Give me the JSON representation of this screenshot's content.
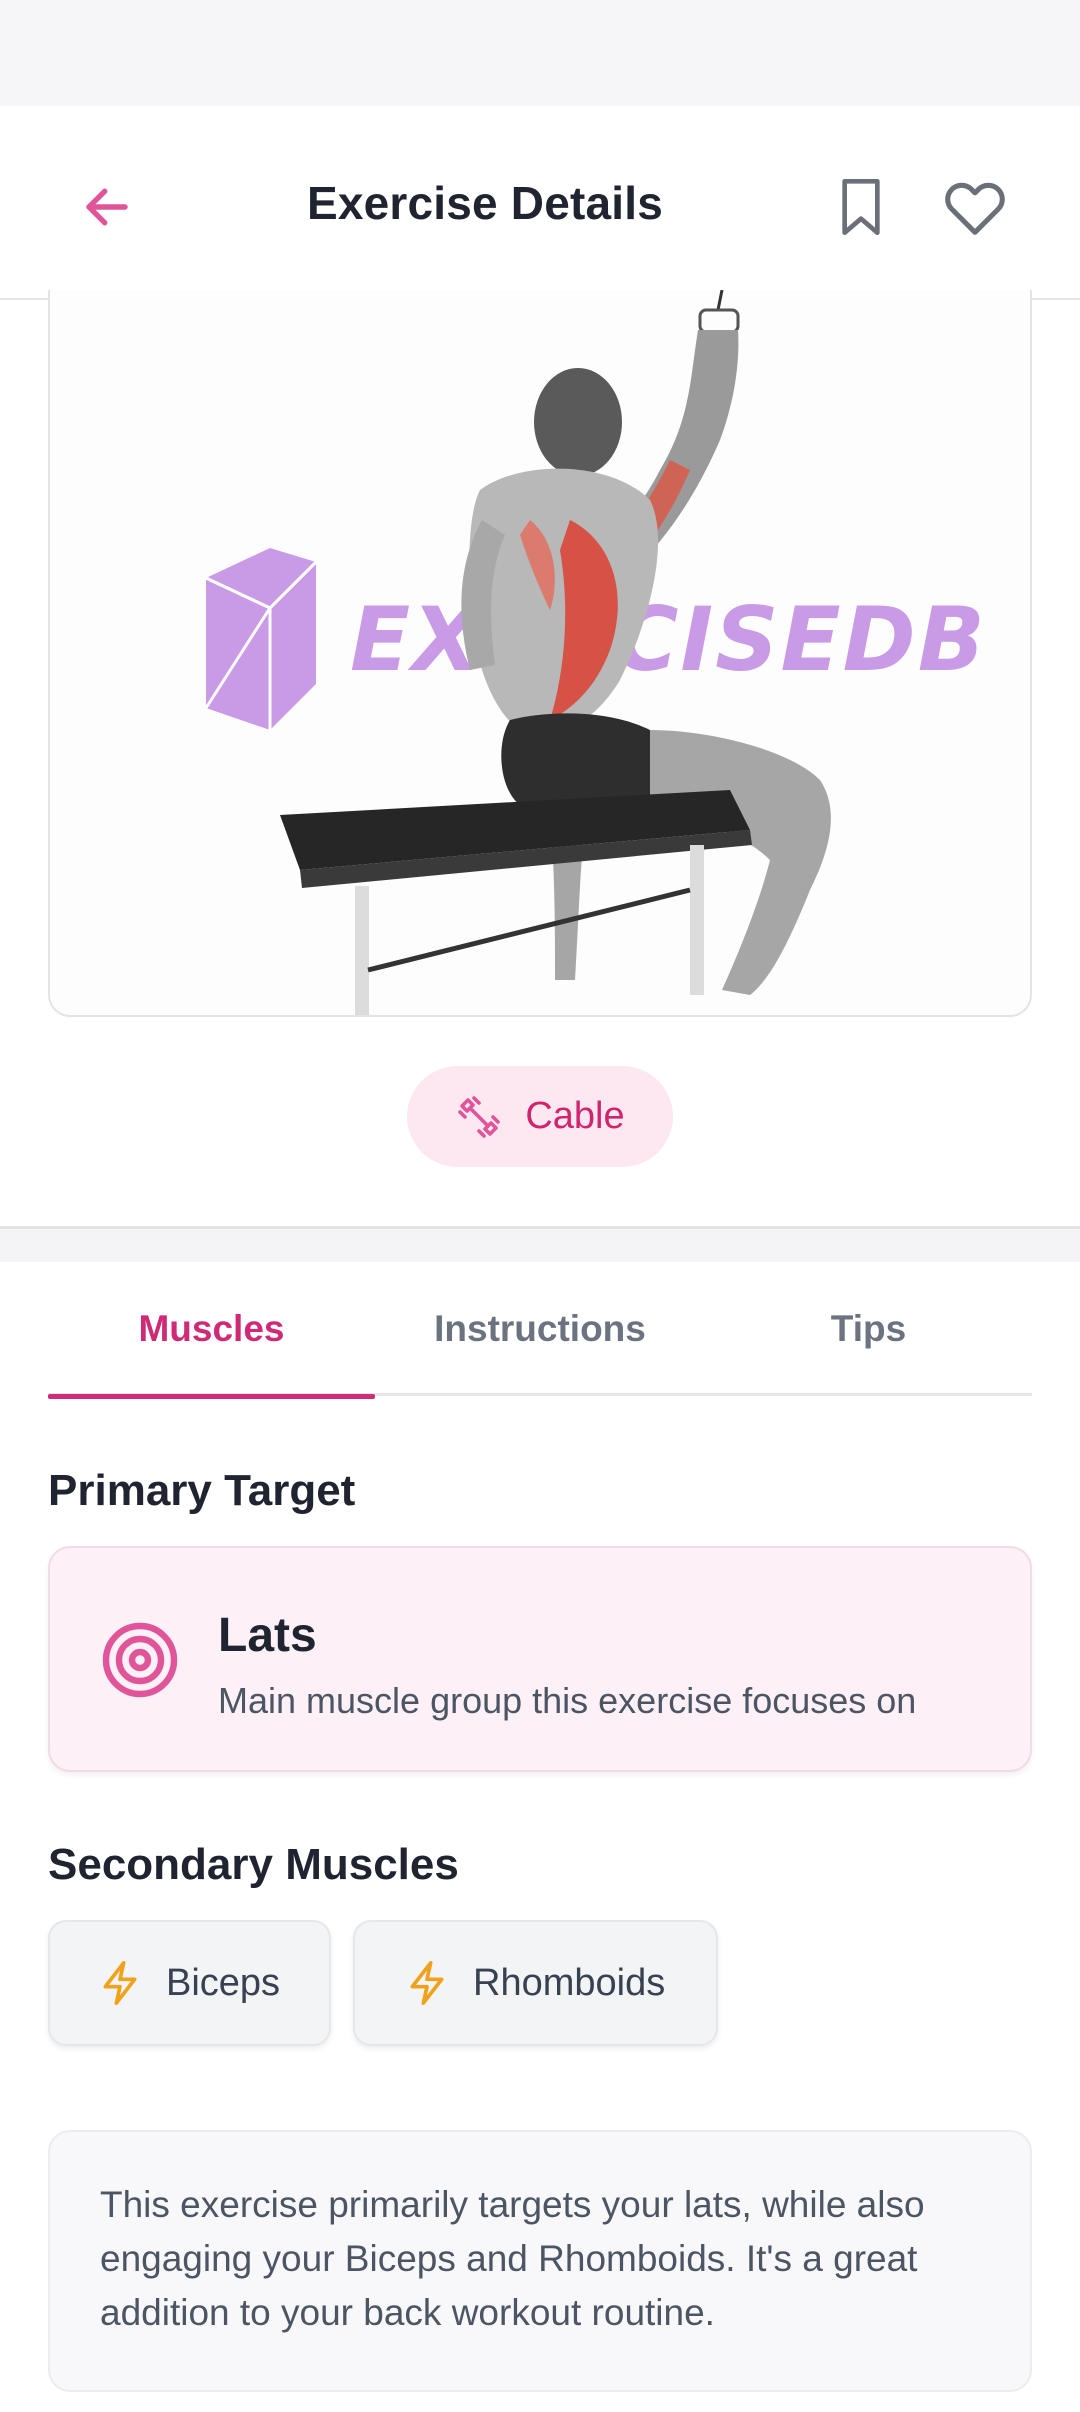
{
  "header": {
    "title": "Exercise Details",
    "back_icon": "arrow-left-icon",
    "bookmark_icon": "bookmark-icon",
    "favorite_icon": "heart-icon",
    "accent_color": "#E0559A"
  },
  "exercise_image": {
    "watermark_text": "EXERCISEDB"
  },
  "equipment": {
    "label": "Cable",
    "icon": "dumbbell-icon"
  },
  "tabs": [
    {
      "label": "Muscles",
      "active": true
    },
    {
      "label": "Instructions",
      "active": false
    },
    {
      "label": "Tips",
      "active": false
    }
  ],
  "primary": {
    "heading": "Primary Target",
    "muscle": "Lats",
    "description": "Main muscle group this exercise focuses on",
    "icon": "target-icon"
  },
  "secondary": {
    "heading": "Secondary Muscles",
    "items": [
      {
        "label": "Biceps",
        "icon": "lightning-icon"
      },
      {
        "label": "Rhomboids",
        "icon": "lightning-icon"
      }
    ]
  },
  "summary": {
    "text": "This exercise primarily targets your lats, while also engaging your Biceps and Rhomboids. It's a great addition to your back workout routine."
  }
}
